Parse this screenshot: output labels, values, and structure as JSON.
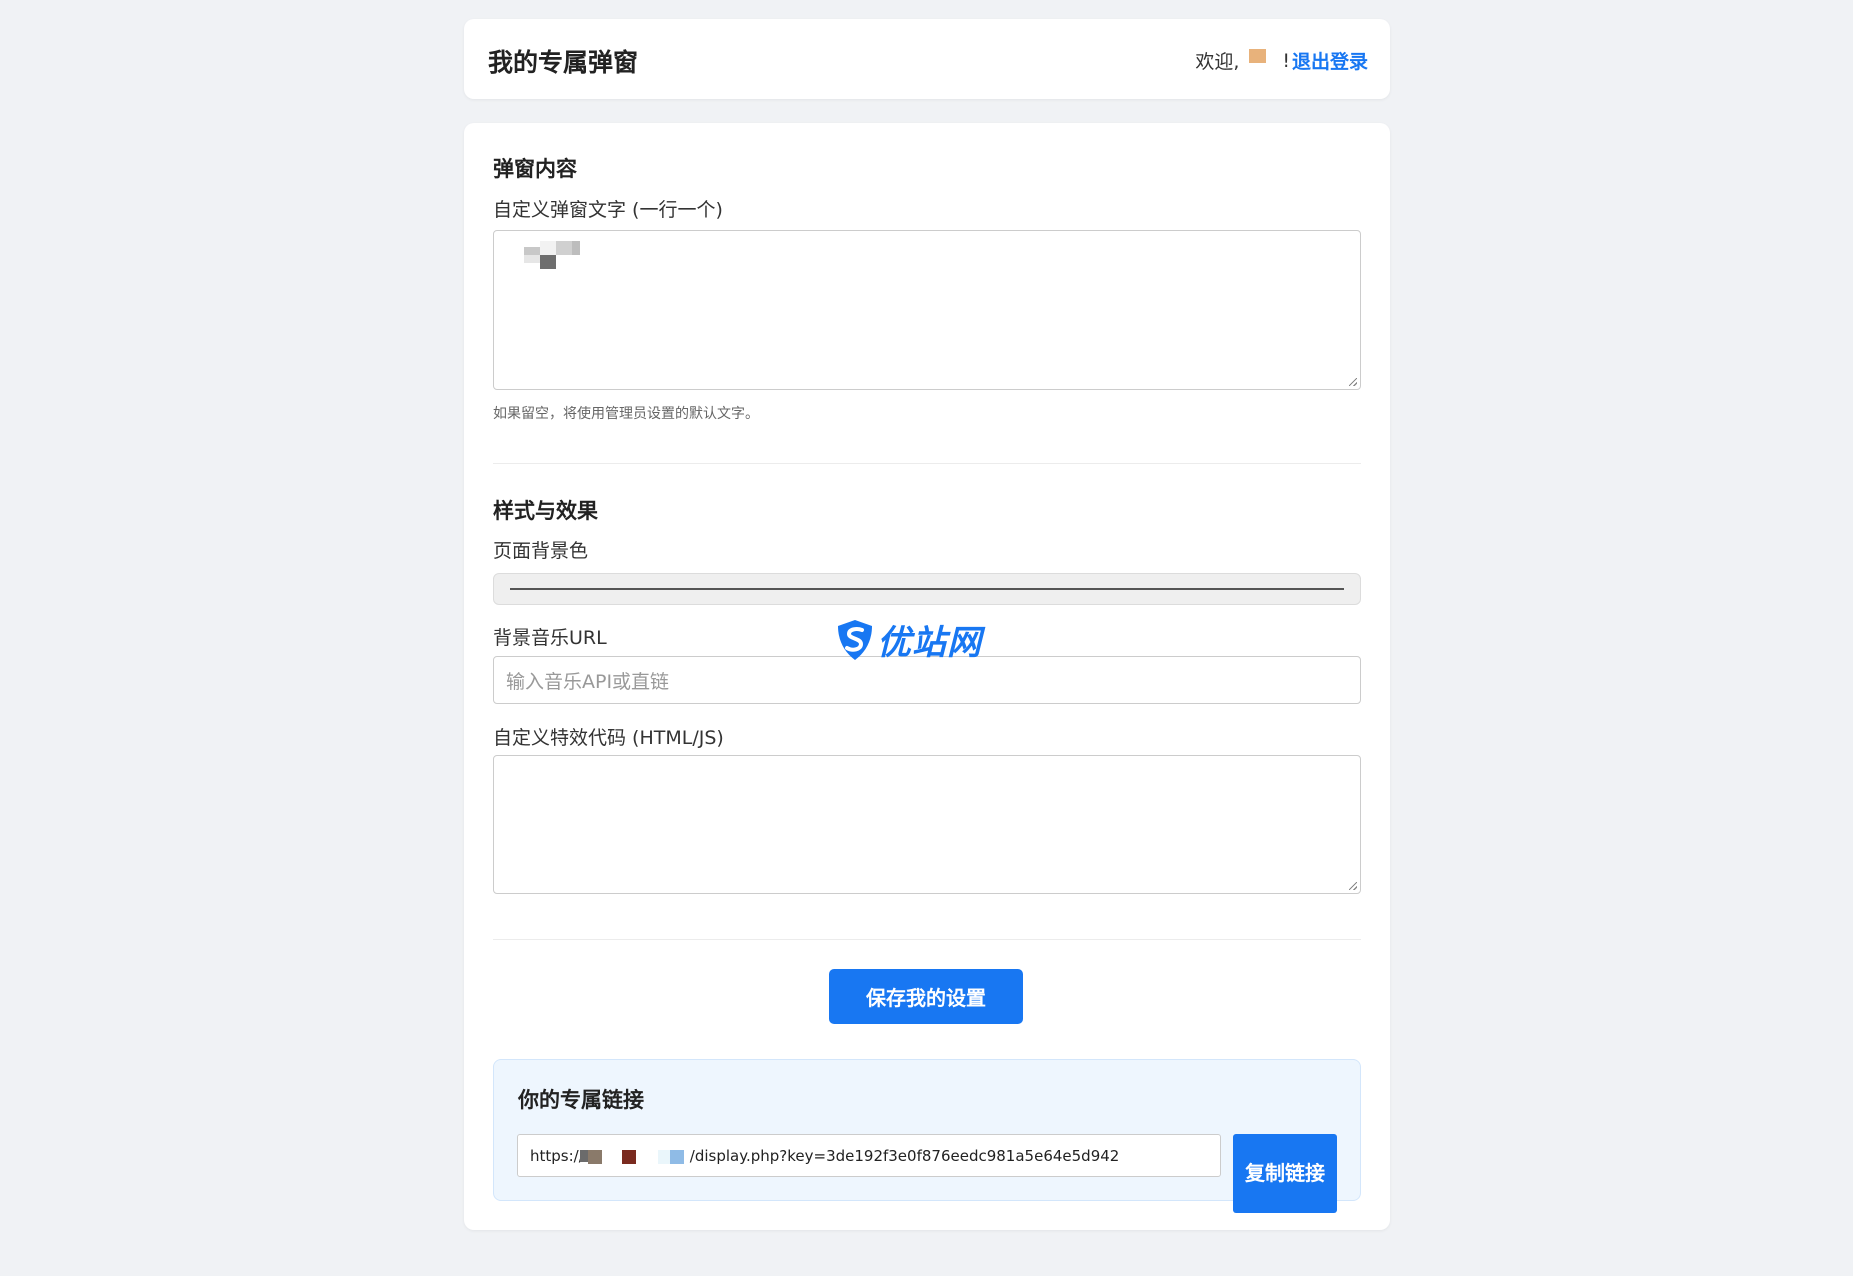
{
  "header": {
    "title": "我的专属弹窗",
    "welcome": "欢迎,",
    "username_tail": "!",
    "logout_label": "退出登录"
  },
  "content_section": {
    "title": "弹窗内容",
    "popup_text_label": "自定义弹窗文字 (一行一个)",
    "hint": "如果留空，将使用管理员设置的默认文字。"
  },
  "style_section": {
    "title": "样式与效果",
    "bg_color_label": "页面背景色",
    "bg_color_value": "#ffffff",
    "music_label": "背景音乐URL",
    "music_placeholder": "输入音乐API或直链",
    "effect_label": "自定义特效代码 (HTML/JS)"
  },
  "save_label": "保存我的设置",
  "link_panel": {
    "title": "你的专属链接",
    "url_prefix": "https://",
    "url_suffix": "/display.php?key=3de192f3e0f876eedc981a5e64e5d942",
    "copy_label": "复制链接"
  },
  "watermark": {
    "text": "优站网"
  },
  "colors": {
    "accent": "#1877f2",
    "background": "#f0f2f5",
    "link_panel_bg": "#eef6fe"
  }
}
